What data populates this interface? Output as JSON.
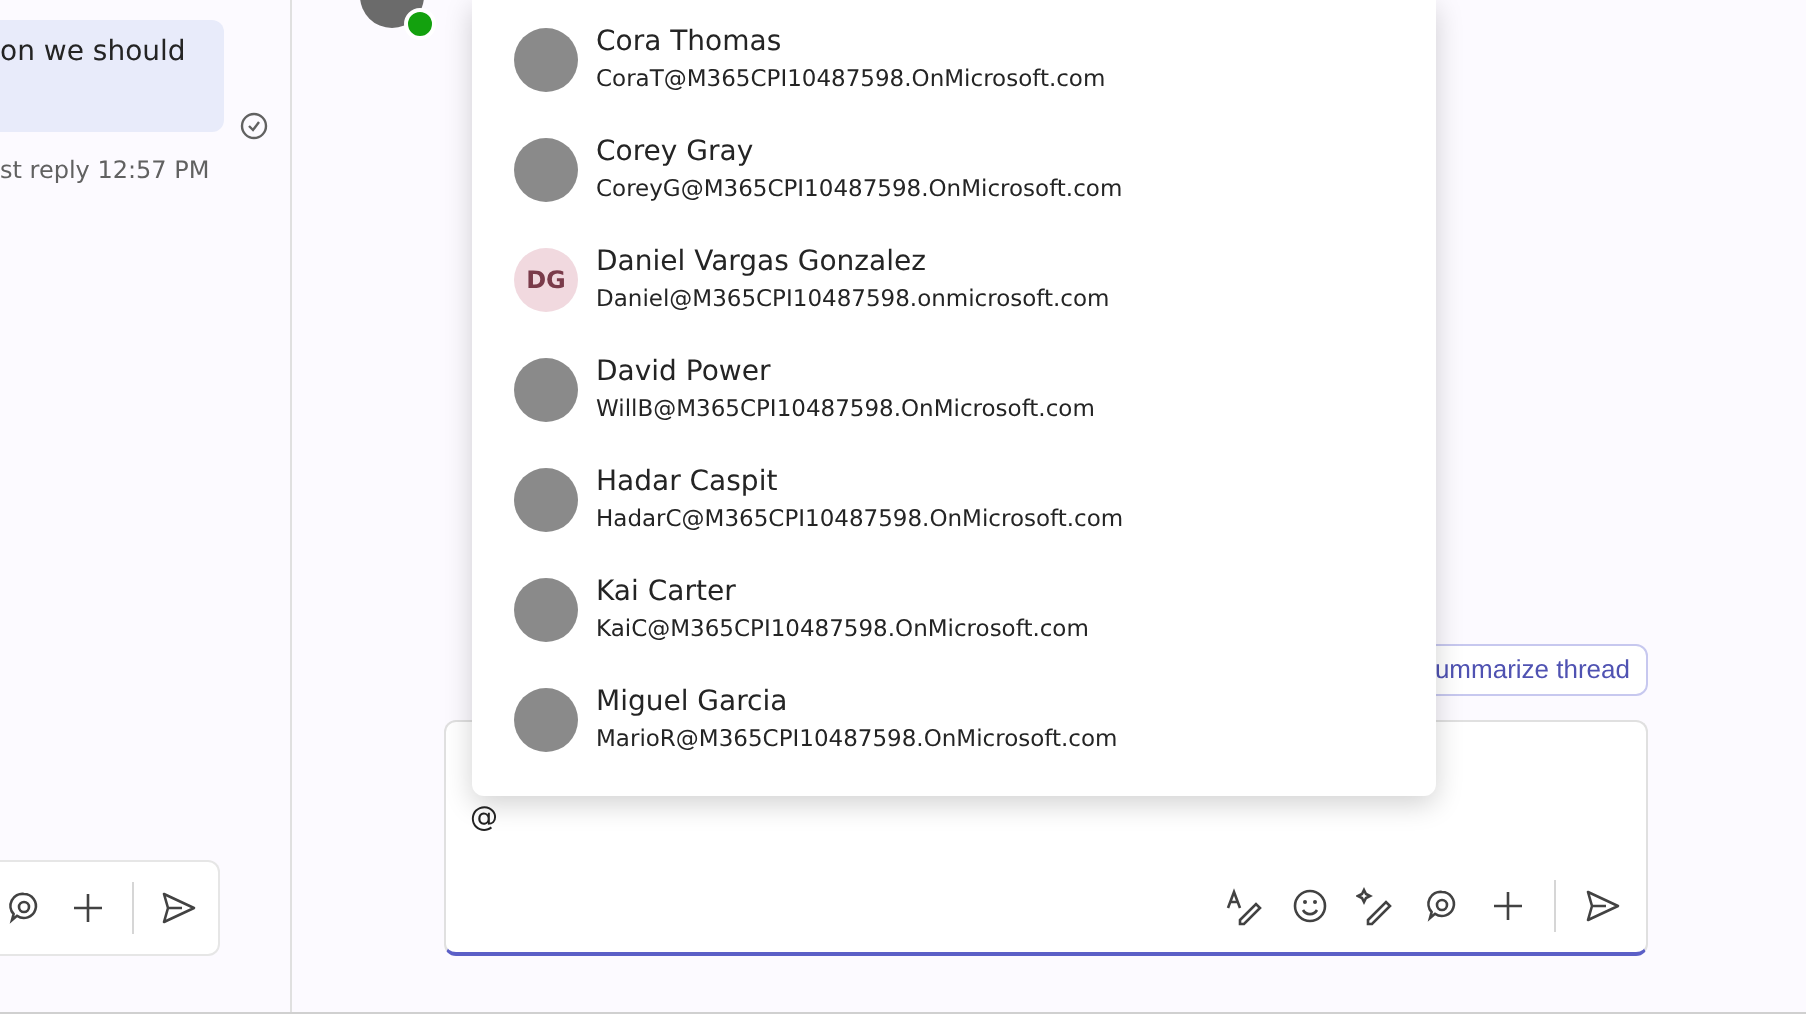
{
  "left_pane": {
    "message": "on we should",
    "last_reply": "st reply 12:57 PM"
  },
  "mention_popup": {
    "people": [
      {
        "name": "Cora Thomas",
        "email": "CoraT@M365CPI10487598.OnMicrosoft.com",
        "kind": "photo"
      },
      {
        "name": "Corey Gray",
        "email": "CoreyG@M365CPI10487598.OnMicrosoft.com",
        "kind": "photo"
      },
      {
        "name": "Daniel Vargas Gonzalez",
        "email": "Daniel@M365CPI10487598.onmicrosoft.com",
        "kind": "initials",
        "initials": "DG"
      },
      {
        "name": "David Power",
        "email": "WillB@M365CPI10487598.OnMicrosoft.com",
        "kind": "photo"
      },
      {
        "name": "Hadar Caspit",
        "email": "HadarC@M365CPI10487598.OnMicrosoft.com",
        "kind": "photo"
      },
      {
        "name": "Kai Carter",
        "email": "KaiC@M365CPI10487598.OnMicrosoft.com",
        "kind": "photo"
      },
      {
        "name": "Miguel Garcia",
        "email": "MarioR@M365CPI10487598.OnMicrosoft.com",
        "kind": "photo"
      }
    ]
  },
  "summarize_button": {
    "label": "ummarize thread"
  },
  "composer": {
    "value": "@"
  }
}
